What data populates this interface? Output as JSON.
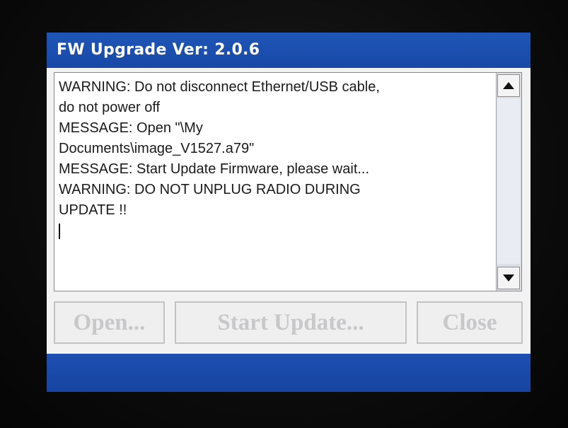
{
  "window": {
    "title": "FW Upgrade Ver: 2.0.6"
  },
  "log": {
    "lines": [
      "WARNING: Do not disconnect Ethernet/USB cable,",
      "do not power off",
      "MESSAGE: Open \"\\My",
      "Documents\\image_V1527.a79\"",
      "MESSAGE: Start Update Firmware, please wait...",
      "WARNING: DO NOT UNPLUG RADIO DURING",
      "UPDATE !!"
    ]
  },
  "scrollbar": {
    "up_icon": "triangle-up-icon",
    "down_icon": "triangle-down-icon"
  },
  "buttons": {
    "open_label": "Open...",
    "start_update_label": "Start Update...",
    "close_label": "Close",
    "state": "disabled"
  },
  "colors": {
    "title_bar": "#1f56b8",
    "status_bar": "#1d4fb2",
    "disabled_text": "#c8c8cb"
  }
}
